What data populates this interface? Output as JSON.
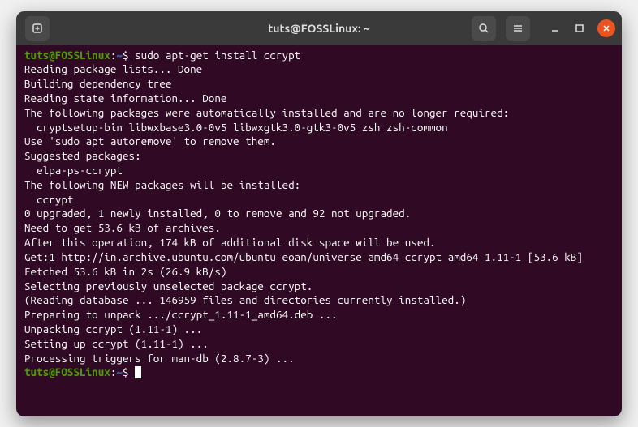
{
  "titlebar": {
    "title": "tuts@FOSSLinux: ~"
  },
  "prompt": {
    "user_host": "tuts@FOSSLinux",
    "colon": ":",
    "path": "~",
    "dollar": "$"
  },
  "command": "sudo apt-get install ccrypt",
  "output": {
    "l1": "Reading package lists... Done",
    "l2": "Building dependency tree",
    "l3": "Reading state information... Done",
    "l4": "The following packages were automatically installed and are no longer required:",
    "l5": "  cryptsetup-bin libwxbase3.0-0v5 libwxgtk3.0-gtk3-0v5 zsh zsh-common",
    "l6": "Use 'sudo apt autoremove' to remove them.",
    "l7": "Suggested packages:",
    "l8": "  elpa-ps-ccrypt",
    "l9": "The following NEW packages will be installed:",
    "l10": "  ccrypt",
    "l11": "0 upgraded, 1 newly installed, 0 to remove and 92 not upgraded.",
    "l12": "Need to get 53.6 kB of archives.",
    "l13": "After this operation, 174 kB of additional disk space will be used.",
    "l14": "Get:1 http://in.archive.ubuntu.com/ubuntu eoan/universe amd64 ccrypt amd64 1.11-1 [53.6 kB]",
    "l15": "Fetched 53.6 kB in 2s (26.9 kB/s)",
    "l16": "Selecting previously unselected package ccrypt.",
    "l17": "(Reading database ... 146959 files and directories currently installed.)",
    "l18": "Preparing to unpack .../ccrypt_1.11-1_amd64.deb ...",
    "l19": "Unpacking ccrypt (1.11-1) ...",
    "l20": "Setting up ccrypt (1.11-1) ...",
    "l21": "Processing triggers for man-db (2.8.7-3) ..."
  }
}
